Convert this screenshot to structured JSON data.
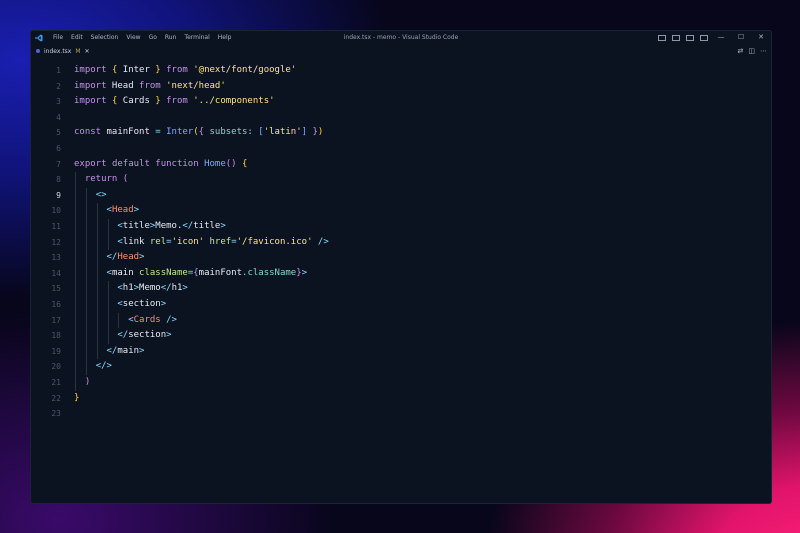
{
  "window": {
    "title": "index.tsx - memo - Visual Studio Code",
    "menu": [
      "File",
      "Edit",
      "Selection",
      "View",
      "Go",
      "Run",
      "Terminal",
      "Help"
    ],
    "controls": {
      "minimize": "—",
      "maximize": "☐",
      "close": "✕"
    }
  },
  "tab": {
    "filename": "index.tsx",
    "modified": "M",
    "close": "✕"
  },
  "editor_actions": [
    "⇄",
    "◫",
    "⋯"
  ],
  "editor": {
    "active_line": 9,
    "lines": [
      {
        "n": "1",
        "tokens": [
          {
            "t": "import",
            "c": "kw"
          },
          {
            "t": " ",
            "c": "plain"
          },
          {
            "t": "{",
            "c": "br"
          },
          {
            "t": " Inter ",
            "c": "id"
          },
          {
            "t": "}",
            "c": "br"
          },
          {
            "t": " ",
            "c": "plain"
          },
          {
            "t": "from",
            "c": "kw"
          },
          {
            "t": " ",
            "c": "plain"
          },
          {
            "t": "'@next/font/google'",
            "c": "str"
          }
        ]
      },
      {
        "n": "2",
        "tokens": [
          {
            "t": "import",
            "c": "kw"
          },
          {
            "t": " Head ",
            "c": "id"
          },
          {
            "t": "from",
            "c": "kw"
          },
          {
            "t": " ",
            "c": "plain"
          },
          {
            "t": "'next/head'",
            "c": "str"
          }
        ]
      },
      {
        "n": "3",
        "tokens": [
          {
            "t": "import",
            "c": "kw"
          },
          {
            "t": " ",
            "c": "plain"
          },
          {
            "t": "{",
            "c": "br"
          },
          {
            "t": " Cards ",
            "c": "id"
          },
          {
            "t": "}",
            "c": "br"
          },
          {
            "t": " ",
            "c": "plain"
          },
          {
            "t": "from",
            "c": "kw"
          },
          {
            "t": " ",
            "c": "plain"
          },
          {
            "t": "'../components'",
            "c": "str"
          }
        ]
      },
      {
        "n": "4",
        "tokens": []
      },
      {
        "n": "5",
        "tokens": [
          {
            "t": "const",
            "c": "kw"
          },
          {
            "t": " mainFont ",
            "c": "id"
          },
          {
            "t": "=",
            "c": "punc"
          },
          {
            "t": " ",
            "c": "plain"
          },
          {
            "t": "Inter",
            "c": "fn"
          },
          {
            "t": "(",
            "c": "br"
          },
          {
            "t": "{",
            "c": "br2"
          },
          {
            "t": " subsets",
            "c": "prop"
          },
          {
            "t": ":",
            "c": "punc"
          },
          {
            "t": " ",
            "c": "plain"
          },
          {
            "t": "[",
            "c": "fn"
          },
          {
            "t": "'latin'",
            "c": "str"
          },
          {
            "t": "]",
            "c": "fn"
          },
          {
            "t": " ",
            "c": "plain"
          },
          {
            "t": "}",
            "c": "br2"
          },
          {
            "t": ")",
            "c": "br"
          }
        ]
      },
      {
        "n": "6",
        "tokens": []
      },
      {
        "n": "7",
        "tokens": [
          {
            "t": "export",
            "c": "kw"
          },
          {
            "t": " ",
            "c": "plain"
          },
          {
            "t": "default",
            "c": "kw"
          },
          {
            "t": " ",
            "c": "plain"
          },
          {
            "t": "function",
            "c": "kw"
          },
          {
            "t": " ",
            "c": "plain"
          },
          {
            "t": "Home",
            "c": "fn"
          },
          {
            "t": "()",
            "c": "br2"
          },
          {
            "t": " ",
            "c": "plain"
          },
          {
            "t": "{",
            "c": "br"
          }
        ]
      },
      {
        "n": "8",
        "tokens": [
          {
            "t": "  ",
            "c": "plain"
          },
          {
            "t": "return",
            "c": "kw"
          },
          {
            "t": " ",
            "c": "plain"
          },
          {
            "t": "(",
            "c": "br2"
          }
        ]
      },
      {
        "n": "9",
        "tokens": [
          {
            "t": "    ",
            "c": "plain"
          },
          {
            "t": "<>",
            "c": "punc"
          }
        ]
      },
      {
        "n": "10",
        "tokens": [
          {
            "t": "      ",
            "c": "plain"
          },
          {
            "t": "<",
            "c": "punc"
          },
          {
            "t": "Head",
            "c": "tag"
          },
          {
            "t": ">",
            "c": "punc"
          }
        ]
      },
      {
        "n": "11",
        "tokens": [
          {
            "t": "        ",
            "c": "plain"
          },
          {
            "t": "<",
            "c": "punc"
          },
          {
            "t": "title",
            "c": "tagname"
          },
          {
            "t": ">",
            "c": "punc"
          },
          {
            "t": "Memo.",
            "c": "plain"
          },
          {
            "t": "</",
            "c": "punc"
          },
          {
            "t": "title",
            "c": "tagname"
          },
          {
            "t": ">",
            "c": "punc"
          }
        ]
      },
      {
        "n": "12",
        "tokens": [
          {
            "t": "        ",
            "c": "plain"
          },
          {
            "t": "<",
            "c": "punc"
          },
          {
            "t": "link",
            "c": "tagname"
          },
          {
            "t": " ",
            "c": "plain"
          },
          {
            "t": "rel",
            "c": "attr"
          },
          {
            "t": "=",
            "c": "punc"
          },
          {
            "t": "'icon'",
            "c": "str"
          },
          {
            "t": " ",
            "c": "plain"
          },
          {
            "t": "href",
            "c": "attr"
          },
          {
            "t": "=",
            "c": "punc"
          },
          {
            "t": "'/favicon.ico'",
            "c": "str"
          },
          {
            "t": " ",
            "c": "plain"
          },
          {
            "t": "/>",
            "c": "punc"
          }
        ]
      },
      {
        "n": "13",
        "tokens": [
          {
            "t": "      ",
            "c": "plain"
          },
          {
            "t": "</",
            "c": "punc"
          },
          {
            "t": "Head",
            "c": "tag"
          },
          {
            "t": ">",
            "c": "punc"
          }
        ]
      },
      {
        "n": "14",
        "tokens": [
          {
            "t": "      ",
            "c": "plain"
          },
          {
            "t": "<",
            "c": "punc"
          },
          {
            "t": "main",
            "c": "tagname"
          },
          {
            "t": " ",
            "c": "plain"
          },
          {
            "t": "className",
            "c": "attr"
          },
          {
            "t": "=",
            "c": "punc"
          },
          {
            "t": "{",
            "c": "br2"
          },
          {
            "t": "mainFont",
            "c": "id"
          },
          {
            "t": ".",
            "c": "punc"
          },
          {
            "t": "className",
            "c": "prop"
          },
          {
            "t": "}",
            "c": "br2"
          },
          {
            "t": ">",
            "c": "punc"
          }
        ]
      },
      {
        "n": "15",
        "tokens": [
          {
            "t": "        ",
            "c": "plain"
          },
          {
            "t": "<",
            "c": "punc"
          },
          {
            "t": "h1",
            "c": "tagname"
          },
          {
            "t": ">",
            "c": "punc"
          },
          {
            "t": "Memo",
            "c": "plain"
          },
          {
            "t": "</",
            "c": "punc"
          },
          {
            "t": "h1",
            "c": "tagname"
          },
          {
            "t": ">",
            "c": "punc"
          }
        ]
      },
      {
        "n": "16",
        "tokens": [
          {
            "t": "        ",
            "c": "plain"
          },
          {
            "t": "<",
            "c": "punc"
          },
          {
            "t": "section",
            "c": "tagname"
          },
          {
            "t": ">",
            "c": "punc"
          }
        ]
      },
      {
        "n": "17",
        "tokens": [
          {
            "t": "          ",
            "c": "plain"
          },
          {
            "t": "<",
            "c": "punc"
          },
          {
            "t": "Cards",
            "c": "tag"
          },
          {
            "t": " ",
            "c": "plain"
          },
          {
            "t": "/>",
            "c": "punc"
          }
        ]
      },
      {
        "n": "18",
        "tokens": [
          {
            "t": "        ",
            "c": "plain"
          },
          {
            "t": "</",
            "c": "punc"
          },
          {
            "t": "section",
            "c": "tagname"
          },
          {
            "t": ">",
            "c": "punc"
          }
        ]
      },
      {
        "n": "19",
        "tokens": [
          {
            "t": "      ",
            "c": "plain"
          },
          {
            "t": "</",
            "c": "punc"
          },
          {
            "t": "main",
            "c": "tagname"
          },
          {
            "t": ">",
            "c": "punc"
          }
        ]
      },
      {
        "n": "20",
        "tokens": [
          {
            "t": "    ",
            "c": "plain"
          },
          {
            "t": "</>",
            "c": "punc"
          }
        ]
      },
      {
        "n": "21",
        "tokens": [
          {
            "t": "  ",
            "c": "plain"
          },
          {
            "t": ")",
            "c": "br2"
          }
        ]
      },
      {
        "n": "22",
        "tokens": [
          {
            "t": "}",
            "c": "br"
          }
        ]
      },
      {
        "n": "23",
        "tokens": []
      }
    ]
  },
  "colors": {
    "editor_bg": "#0b1220",
    "keyword": "#c792ea",
    "string": "#ffe585",
    "function": "#82aaff",
    "component_tag": "#ff8f66",
    "attribute": "#c3e88d",
    "accent_pink": "#ff1f7a",
    "accent_blue": "#1a1fb0"
  }
}
